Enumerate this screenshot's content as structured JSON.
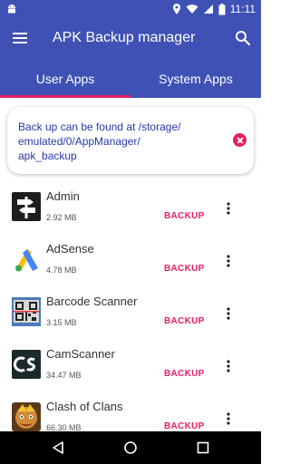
{
  "status_bar": {
    "time": "11:11",
    "left_icons": [
      "android-icon"
    ],
    "right_icons": [
      "location-icon",
      "wifi-icon",
      "signal-icon",
      "battery-icon"
    ]
  },
  "app_bar": {
    "title": "APK Backup manager",
    "menu_icon": "hamburger-menu-icon",
    "search_icon": "search-icon"
  },
  "tabs": [
    {
      "label": "User Apps",
      "active": true
    },
    {
      "label": "System Apps",
      "active": false
    }
  ],
  "banner": {
    "text": "Back up can be found at /storage/emulated/0/AppManager/apk_backup",
    "line1": "Back up can be found at /storage/",
    "line2": "emulated/0/AppManager/",
    "line3": "apk_backup",
    "close_icon": "close-icon"
  },
  "apps": [
    {
      "name": "Admin",
      "size": "2.92 MB",
      "action": "BACKUP",
      "icon": "admin-signpost-icon"
    },
    {
      "name": "AdSense",
      "size": "4.78 MB",
      "action": "BACKUP",
      "icon": "adsense-icon"
    },
    {
      "name": "Barcode Scanner",
      "size": "3.15 MB",
      "action": "BACKUP",
      "icon": "barcode-scanner-icon"
    },
    {
      "name": "CamScanner",
      "size": "34.47 MB",
      "action": "BACKUP",
      "icon": "camscanner-icon"
    },
    {
      "name": "Clash of Clans",
      "size": "66.30 MB",
      "action": "BACKUP",
      "icon": "clash-of-clans-icon"
    }
  ],
  "colors": {
    "primary": "#3f51b5",
    "accent": "#e91e63",
    "banner_text": "#2639a8"
  },
  "nav_bar": {
    "icons": [
      "back-icon",
      "home-icon",
      "recent-apps-icon"
    ]
  }
}
